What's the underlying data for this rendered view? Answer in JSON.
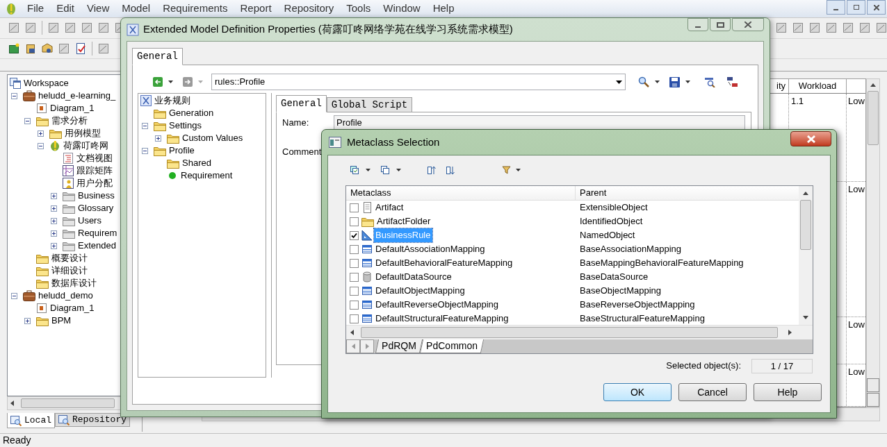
{
  "menu": [
    "File",
    "Edit",
    "View",
    "Model",
    "Requirements",
    "Report",
    "Repository",
    "Tools",
    "Window",
    "Help"
  ],
  "workspace_tree": [
    {
      "label": "Workspace",
      "kind": "workspace",
      "children": [
        {
          "label": "heludd_e-learning_",
          "kind": "model",
          "expanded": true,
          "children": [
            {
              "label": "Diagram_1",
              "kind": "diagram"
            },
            {
              "label": "需求分析",
              "kind": "folder",
              "expanded": true,
              "children": [
                {
                  "label": "用例模型",
                  "kind": "folder",
                  "expanded": false
                },
                {
                  "label": "荷露叮咚网",
                  "kind": "requirement-model",
                  "expanded": true,
                  "children": [
                    {
                      "label": "文档视图",
                      "kind": "document"
                    },
                    {
                      "label": "跟踪矩阵",
                      "kind": "matrix"
                    },
                    {
                      "label": "用户分配",
                      "kind": "allocation"
                    },
                    {
                      "label": "Business",
                      "kind": "grey-folder",
                      "expanded": false
                    },
                    {
                      "label": "Glossary",
                      "kind": "grey-folder",
                      "expanded": false
                    },
                    {
                      "label": "Users",
                      "kind": "grey-folder",
                      "expanded": false
                    },
                    {
                      "label": "Requirem",
                      "kind": "grey-folder",
                      "expanded": false
                    },
                    {
                      "label": "Extended",
                      "kind": "grey-folder",
                      "expanded": false
                    }
                  ]
                }
              ]
            },
            {
              "label": "概要设计",
              "kind": "folder"
            },
            {
              "label": "详细设计",
              "kind": "folder"
            },
            {
              "label": "数据库设计",
              "kind": "folder"
            }
          ]
        },
        {
          "label": "heludd_demo",
          "kind": "model",
          "expanded": true,
          "children": [
            {
              "label": "Diagram_1",
              "kind": "diagram"
            },
            {
              "label": "BPM",
              "kind": "folder",
              "expanded": false
            }
          ]
        }
      ]
    }
  ],
  "panel_tabs": [
    {
      "label": "Local",
      "selected": true
    },
    {
      "label": "Repository",
      "selected": false
    }
  ],
  "requirements_table": {
    "columns": [
      "ity",
      "Workload"
    ],
    "rows": [
      {
        "workload": "1.1",
        "column_3": "Low"
      },
      {
        "column_3": "Low"
      },
      {
        "column_3": "Low"
      },
      {
        "column_3": "Low"
      }
    ]
  },
  "status_bar": "Ready",
  "properties_dialog": {
    "title": "Extended Model Definition Properties (荷露叮咚网络学苑在线学习系统需求模型)",
    "tabs": [
      {
        "label": "General",
        "selected": true
      }
    ],
    "path": "rules::Profile",
    "tree": [
      {
        "label": "业务规则",
        "kind": "rule-set",
        "children": [
          {
            "label": "Generation",
            "kind": "folder"
          },
          {
            "label": "Settings",
            "kind": "folder",
            "expanded": true,
            "children": [
              {
                "label": "Custom Values",
                "kind": "folder",
                "expanded": false
              }
            ]
          },
          {
            "label": "Profile",
            "kind": "folder",
            "expanded": true,
            "children": [
              {
                "label": "Shared",
                "kind": "folder"
              },
              {
                "label": "Requirement",
                "kind": "stereotype"
              }
            ]
          }
        ]
      }
    ],
    "detail_tabs": [
      {
        "label": "General",
        "selected": true
      },
      {
        "label": "Global Script",
        "selected": false
      }
    ],
    "name_label": "Name:",
    "name_value": "Profile",
    "comment_label": "Comment"
  },
  "metaclass_dialog": {
    "title": "Metaclass Selection",
    "columns": [
      "Metaclass",
      "Parent"
    ],
    "rows": [
      {
        "name": "Artifact",
        "parent": "ExtensibleObject",
        "kind": "artifact",
        "checked": false,
        "selected": false
      },
      {
        "name": "ArtifactFolder",
        "parent": "IdentifiedObject",
        "kind": "folder",
        "checked": false,
        "selected": false
      },
      {
        "name": "BusinessRule",
        "parent": "NamedObject",
        "kind": "rule",
        "checked": true,
        "selected": true
      },
      {
        "name": "DefaultAssociationMapping",
        "parent": "BaseAssociationMapping",
        "kind": "mapping",
        "checked": false,
        "selected": false
      },
      {
        "name": "DefaultBehavioralFeatureMapping",
        "parent": "BaseMappingBehavioralFeatureMapping",
        "kind": "mapping",
        "checked": false,
        "selected": false
      },
      {
        "name": "DefaultDataSource",
        "parent": "BaseDataSource",
        "kind": "datasource",
        "checked": false,
        "selected": false
      },
      {
        "name": "DefaultObjectMapping",
        "parent": "BaseObjectMapping",
        "kind": "mapping",
        "checked": false,
        "selected": false
      },
      {
        "name": "DefaultReverseObjectMapping",
        "parent": "BaseReverseObjectMapping",
        "kind": "mapping",
        "checked": false,
        "selected": false
      },
      {
        "name": "DefaultStructuralFeatureMapping",
        "parent": "BaseStructuralFeatureMapping",
        "kind": "mapping",
        "checked": false,
        "selected": false
      }
    ],
    "sheet_tabs": [
      {
        "label": "PdRQM",
        "selected": false
      },
      {
        "label": "PdCommon",
        "selected": true
      }
    ],
    "selected_label": "Selected object(s):",
    "selected_count": "1 / 17",
    "buttons": [
      "OK",
      "Cancel",
      "Help"
    ]
  }
}
